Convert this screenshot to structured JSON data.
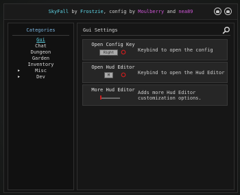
{
  "title": {
    "app_name": "SkyFall",
    "by1": "by",
    "author1": "Frostzie",
    "config_by": ", config by",
    "author2": "Moulberry",
    "and": "and",
    "author3": "nea89"
  },
  "title_icons": [
    "github-icon",
    "discord-icon"
  ],
  "sidebar": {
    "title": "Categories",
    "items": [
      {
        "label": "Gui",
        "active": true,
        "expandable": false
      },
      {
        "label": "Chat",
        "active": false,
        "expandable": false
      },
      {
        "label": "Dungeon",
        "active": false,
        "expandable": false
      },
      {
        "label": "Garden",
        "active": false,
        "expandable": false
      },
      {
        "label": "Inventory",
        "active": false,
        "expandable": false
      },
      {
        "label": "Misc",
        "active": false,
        "expandable": true
      },
      {
        "label": "Dev",
        "active": false,
        "expandable": true
      }
    ]
  },
  "main": {
    "title": "Gui Settings",
    "search_icon": "search-icon",
    "options": [
      {
        "name": "Open Config Key",
        "description": "Keybind to open the config",
        "control": "keybind",
        "key": "Right Shift"
      },
      {
        "name": "Open Hud Editor",
        "description": "Keybind to open the Hud Editor",
        "control": "keybind",
        "key": "M"
      },
      {
        "name": "More Hud Editor",
        "description": "Adds more Hud Editor customization options.",
        "control": "slider",
        "slider_value": 0
      }
    ]
  },
  "colors": {
    "accent_cyan": "#5fd7e8",
    "author_magenta": "#d157d9",
    "category_title": "#7db6e0",
    "reset_red": "#c81e1e"
  }
}
